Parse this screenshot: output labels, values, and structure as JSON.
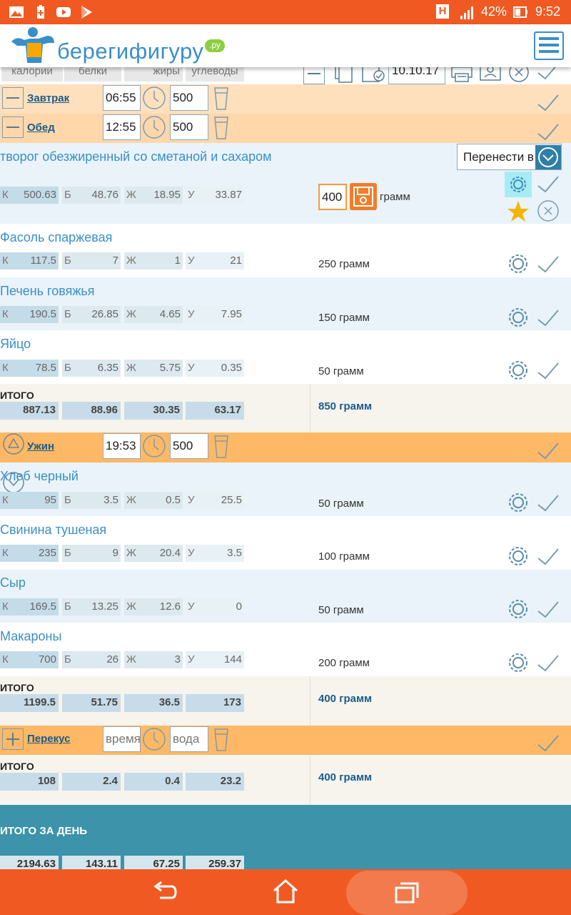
{
  "status_bar": {
    "battery_percent": "42%",
    "time": "9:52",
    "network_badge": "H"
  },
  "header": {
    "logo_text": "берегифигуру",
    "logo_domain": ".ру"
  },
  "column_headers": [
    "калории",
    "белки",
    "жиры",
    "углеводы"
  ],
  "toolbar": {
    "date_value": "10.10.17"
  },
  "meals": {
    "breakfast": {
      "name": "Завтрак",
      "time": "06:55",
      "water": "500"
    },
    "lunch": {
      "name": "Обед",
      "time": "12:55",
      "water": "500",
      "move_dropdown": "Перенести в",
      "foods": [
        {
          "name": "творог обезжиренный со сметаной и сахаром",
          "k": "500.63",
          "b": "48.76",
          "f": "18.95",
          "u": "33.87",
          "grams_value": "400",
          "grams_unit": "грамм"
        },
        {
          "name": "Фасоль спаржевая",
          "k": "117.5",
          "b": "7",
          "f": "1",
          "u": "21",
          "grams": "250 грамм"
        },
        {
          "name": "Печень говяжья",
          "k": "190.5",
          "b": "26.85",
          "f": "4.65",
          "u": "7.95",
          "grams": "150 грамм"
        },
        {
          "name": "Яйцо",
          "k": "78.5",
          "b": "6.35",
          "f": "5.75",
          "u": "0.35",
          "grams": "50 грамм"
        }
      ],
      "total": {
        "title": "ИТОГО",
        "k": "887.13",
        "b": "88.96",
        "f": "30.35",
        "u": "63.17",
        "grams": "850 грамм"
      }
    },
    "dinner": {
      "name": "Ужин",
      "time": "19:53",
      "water": "500",
      "foods": [
        {
          "name": "Хлеб черный",
          "k": "95",
          "b": "3.5",
          "f": "0.5",
          "u": "25.5",
          "grams": "50 грамм"
        },
        {
          "name": "Свинина тушеная",
          "k": "235",
          "b": "9",
          "f": "20.4",
          "u": "3.5",
          "grams": "100 грамм"
        },
        {
          "name": "Сыр",
          "k": "169.5",
          "b": "13.25",
          "f": "12.6",
          "u": "0",
          "grams": "50 грамм"
        },
        {
          "name": "Макароны",
          "k": "700",
          "b": "26",
          "f": "3",
          "u": "144",
          "grams": "200 грамм"
        }
      ],
      "total": {
        "title": "ИТОГО",
        "k": "1199.5",
        "b": "51.75",
        "f": "36.5",
        "u": "173",
        "grams": "400 грамм"
      }
    },
    "snack": {
      "name": "Перекус",
      "time_placeholder": "время",
      "water_placeholder": "вода",
      "total": {
        "title": "ИТОГО",
        "k": "108",
        "b": "2.4",
        "f": "0.4",
        "u": "23.2",
        "grams": "400 грамм"
      }
    }
  },
  "nutrient_letters": {
    "k": "К",
    "b": "Б",
    "f": "Ж",
    "u": "У"
  },
  "day_total": {
    "title": "ИТОГО ЗА ДЕНЬ",
    "k": "2194.63",
    "b": "143.11",
    "f": "67.25",
    "u": "259.37"
  },
  "colors": {
    "status_bar": "#f05a22",
    "brand_blue": "#3a8fc8",
    "meal_band_light": "#ffe0bd",
    "meal_band_dark": "#ffb865",
    "day_total_bg": "#3c93aa"
  }
}
